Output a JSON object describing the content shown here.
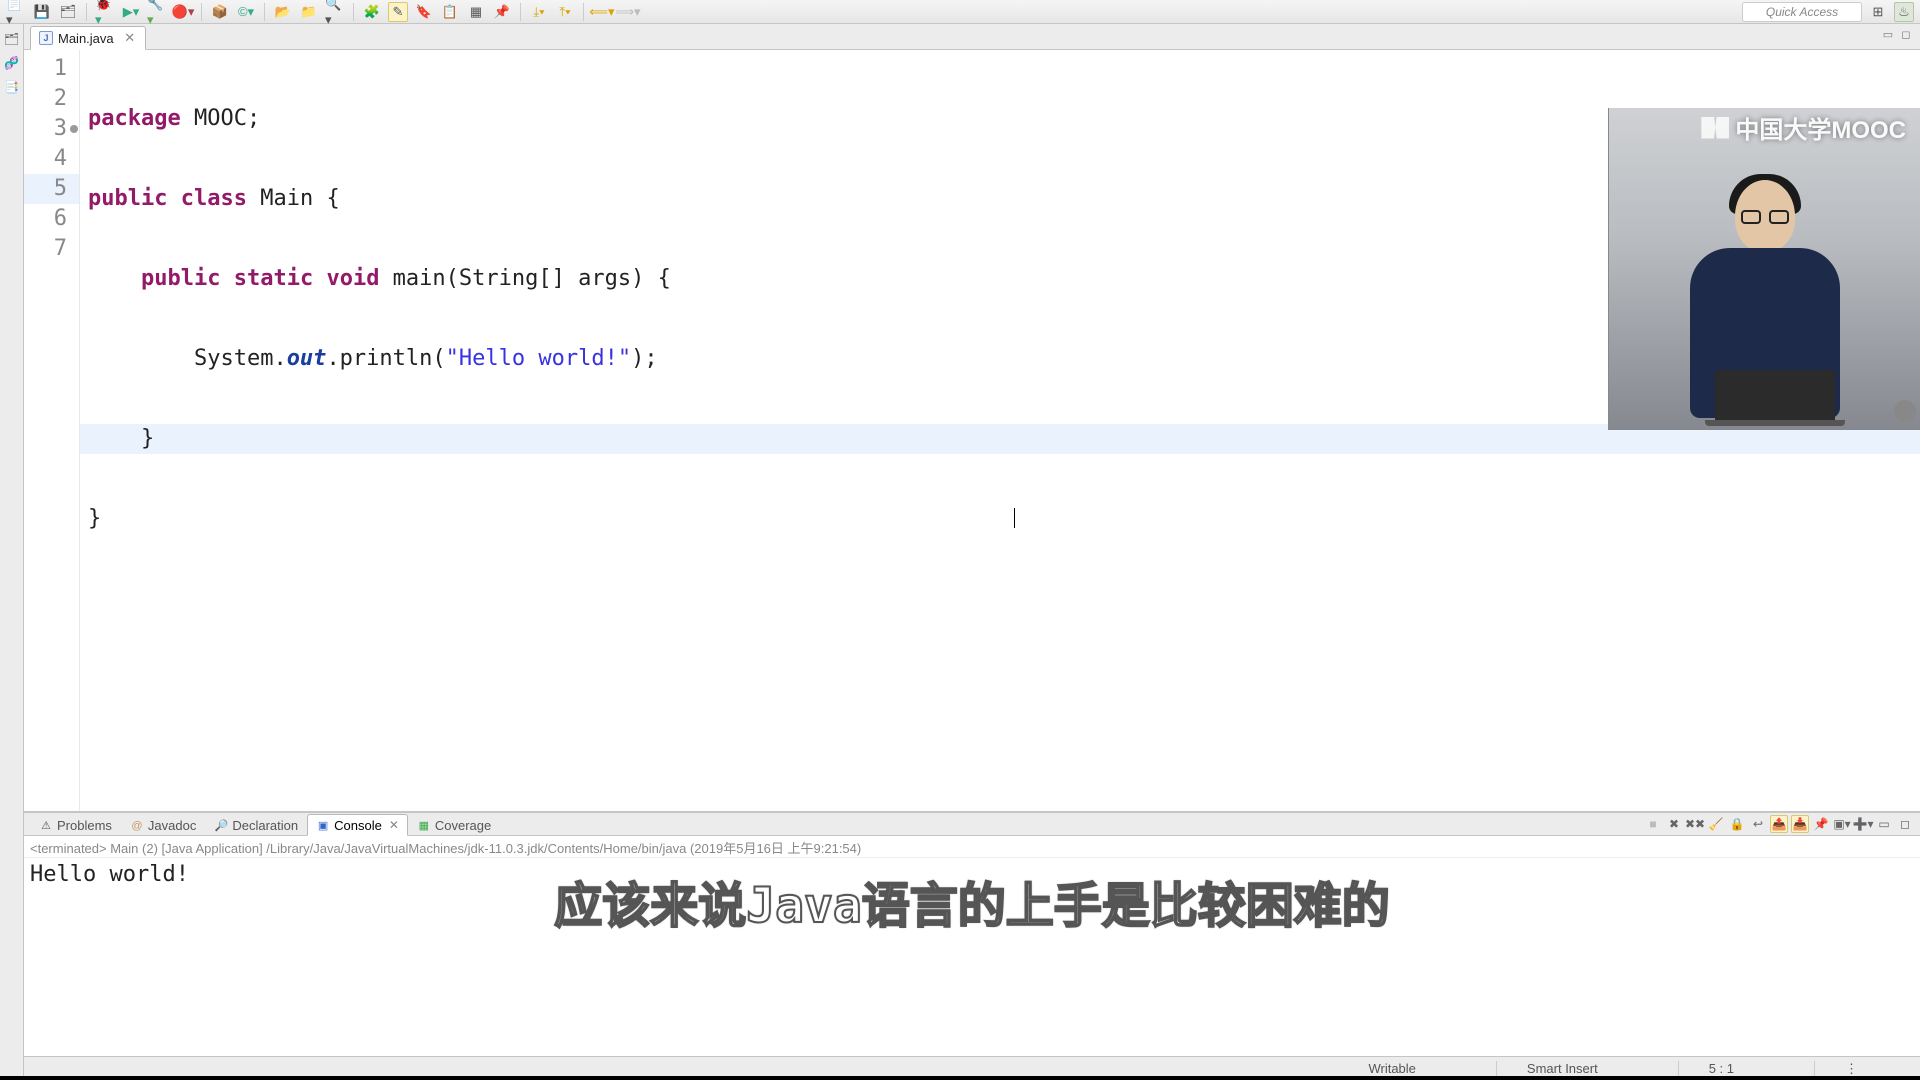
{
  "toolbar": {
    "quick_access": "Quick Access"
  },
  "left_rail": {
    "items": [
      "📦",
      "🔗",
      "📑"
    ]
  },
  "editor": {
    "tab_label": "Main.java",
    "lines": [
      {
        "n": "1"
      },
      {
        "n": "2"
      },
      {
        "n": "3"
      },
      {
        "n": "4"
      },
      {
        "n": "5"
      },
      {
        "n": "6"
      },
      {
        "n": "7"
      }
    ],
    "code": {
      "l1": {
        "kw1": "package",
        "rest": " MOOC;"
      },
      "l2": {
        "kw1": "public",
        "kw2": "class",
        "rest": " Main {"
      },
      "l3": {
        "indent": "    ",
        "kw1": "public",
        "kw2": "static",
        "kw3": "void",
        "rest": " main(String[] args) {"
      },
      "l4": {
        "indent": "        ",
        "p1": "System.",
        "fld": "out",
        "p2": ".println(",
        "str": "\"Hello world!\"",
        "p3": ");"
      },
      "l5": {
        "text": "    }"
      },
      "l6": {
        "text": "}"
      },
      "l7": {
        "text": ""
      }
    }
  },
  "bottom_tabs": {
    "problems": "Problems",
    "javadoc": "Javadoc",
    "declaration": "Declaration",
    "console": "Console",
    "coverage": "Coverage"
  },
  "console": {
    "info": "<terminated> Main (2) [Java Application] /Library/Java/JavaVirtualMachines/jdk-11.0.3.jdk/Contents/Home/bin/java (2019年5月16日 上午9:21:54)",
    "output": "Hello world!"
  },
  "subtitle": "应该来说Java语言的上手是比较困难的",
  "watermark": "中国大学MOOC",
  "status": {
    "writable": "Writable",
    "insert": "Smart Insert",
    "pos": "5 : 1"
  }
}
